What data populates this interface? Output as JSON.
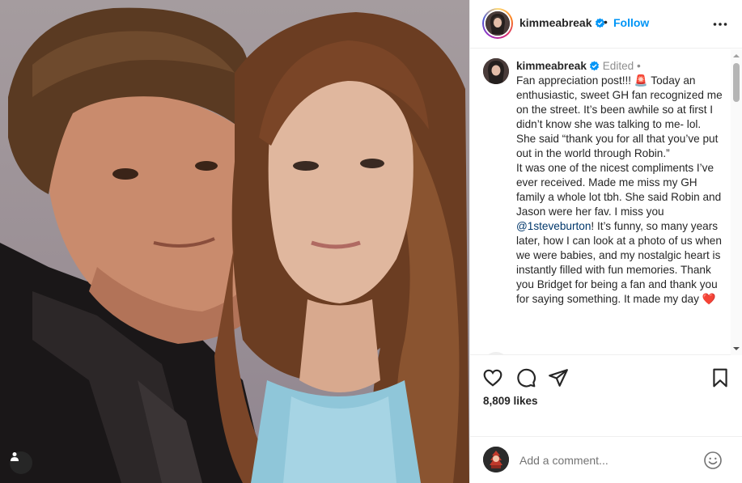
{
  "post": {
    "username": "kimmeabreak",
    "follow_label": "Follow",
    "separator": "•"
  },
  "caption": {
    "username": "kimmeabreak",
    "edited_label": "Edited",
    "edited_sep": "•",
    "text_1": "Fan appreciation post!!! ",
    "emoji_1": "🚨",
    "text_2": " Today an enthusiastic, sweet GH fan recognized me on the street. It’s been awhile so at first I didn’t know she was talking to me- lol. She said “thank you for all that you’ve put out in the world through Robin.”",
    "text_3": "It was one of the nicest compliments I’ve ever received. Made me miss my GH family a whole lot tbh. She said Robin and Jason were her fav. I miss you ",
    "mention": "@1steveburton",
    "text_4": "! It’s funny, so many years later, how I can look at a photo of us when we were babies, and my nostalgic heart is instantly filled with fun memories. Thank you Bridget for being a fan and thank you for saying something. It made my day ",
    "emoji_2": "❤️"
  },
  "stats": {
    "likes": "8,809 likes"
  },
  "composer": {
    "placeholder": "Add a comment..."
  },
  "icons": {
    "more": "more-options-icon",
    "like": "heart-icon",
    "comment": "comment-bubble-icon",
    "share": "paper-plane-icon",
    "save": "bookmark-icon",
    "emoji": "smiley-icon",
    "tag": "user-tag-icon",
    "verified": "verified-badge-icon"
  },
  "colors": {
    "accent": "#0095f6",
    "verified": "#0095f6",
    "mention": "#00376b",
    "muted": "#8e8e8e",
    "heart_emoji": "#e0245e"
  }
}
